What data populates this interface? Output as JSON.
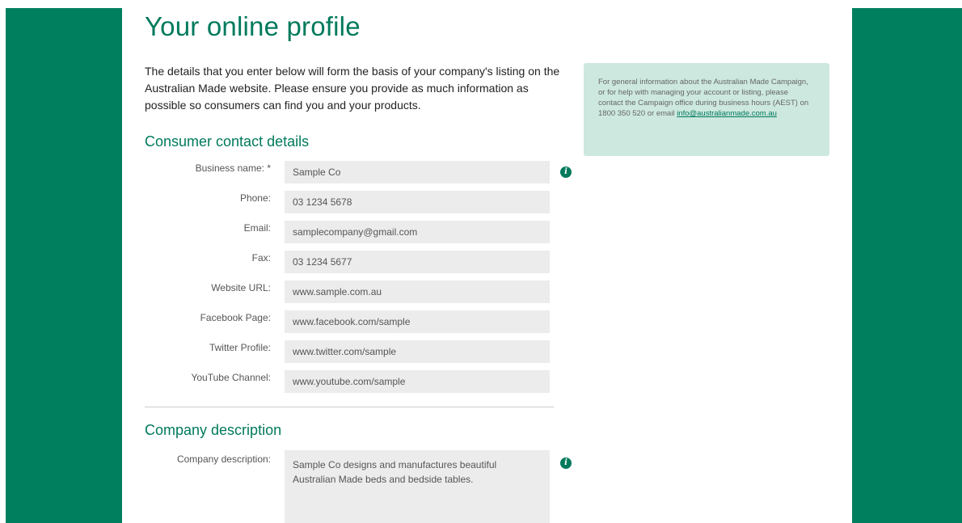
{
  "page": {
    "title": "Your online profile",
    "intro": "The details that you enter below will form the basis of your company's listing on the Australian Made website. Please ensure you provide as much information as possible so consumers can find you and your products."
  },
  "consumer_contact": {
    "heading": "Consumer contact details",
    "fields": [
      {
        "label": "Business name: *",
        "value": "Sample Co"
      },
      {
        "label": "Phone:",
        "value": "03 1234 5678"
      },
      {
        "label": "Email:",
        "value": "samplecompany@gmail.com"
      },
      {
        "label": "Fax:",
        "value": "03 1234 5677"
      },
      {
        "label": "Website URL:",
        "value": "www.sample.com.au"
      },
      {
        "label": "Facebook Page:",
        "value": "www.facebook.com/sample"
      },
      {
        "label": "Twitter Profile:",
        "value": "www.twitter.com/sample"
      },
      {
        "label": "YouTube Channel:",
        "value": "www.youtube.com/sample"
      }
    ]
  },
  "company_description": {
    "heading": "Company description",
    "label": "Company description:",
    "value": "Sample Co designs and manufactures beautiful Australian Made beds and bedside tables."
  },
  "help": {
    "text": "For general information about the Australian Made Campaign, or for help with managing your account or listing, please contact the Campaign office during business hours (AEST) on 1800 350 520 or email",
    "email": "info@australianmade.com.au"
  },
  "icons": {
    "info": "info-icon",
    "info_glyph": "i"
  },
  "colors": {
    "brand_green": "#007f5f",
    "heading_green": "#007a5c",
    "help_bg": "#cde8df",
    "input_bg": "#ececec"
  }
}
